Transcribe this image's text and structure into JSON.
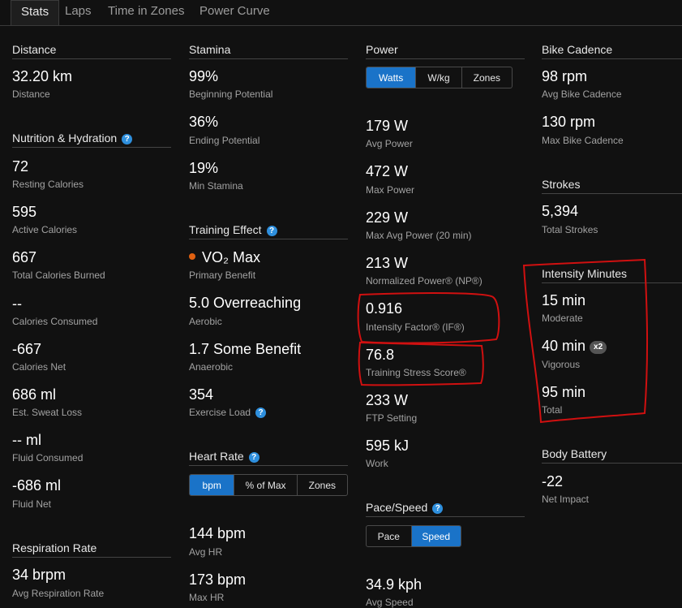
{
  "tabs": [
    "Stats",
    "Laps",
    "Time in Zones",
    "Power Curve"
  ],
  "distance": {
    "title": "Distance",
    "value": "32.20 km",
    "label": "Distance"
  },
  "nutrition": {
    "title": "Nutrition & Hydration",
    "items": [
      {
        "value": "72",
        "label": "Resting Calories"
      },
      {
        "value": "595",
        "label": "Active Calories"
      },
      {
        "value": "667",
        "label": "Total Calories Burned"
      },
      {
        "value": "--",
        "label": "Calories Consumed"
      },
      {
        "value": "-667",
        "label": "Calories Net"
      },
      {
        "value": "686 ml",
        "label": "Est. Sweat Loss"
      },
      {
        "value": "-- ml",
        "label": "Fluid Consumed"
      },
      {
        "value": "-686 ml",
        "label": "Fluid Net"
      }
    ]
  },
  "respiration": {
    "title": "Respiration Rate",
    "value": "34 brpm",
    "label": "Avg Respiration Rate"
  },
  "stamina": {
    "title": "Stamina",
    "items": [
      {
        "value": "99%",
        "label": "Beginning Potential"
      },
      {
        "value": "36%",
        "label": "Ending Potential"
      },
      {
        "value": "19%",
        "label": "Min Stamina"
      }
    ]
  },
  "training_effect": {
    "title": "Training Effect",
    "items": [
      {
        "value": "VO₂ Max",
        "label": "Primary Benefit"
      },
      {
        "value": "5.0 Overreaching",
        "label": "Aerobic"
      },
      {
        "value": "1.7 Some Benefit",
        "label": "Anaerobic"
      },
      {
        "value": "354",
        "label": "Exercise Load"
      }
    ],
    "dot_color": "#e06010"
  },
  "heart_rate": {
    "title": "Heart Rate",
    "toggle": [
      "bpm",
      "% of Max",
      "Zones"
    ],
    "items": [
      {
        "value": "144 bpm",
        "label": "Avg HR"
      },
      {
        "value": "173 bpm",
        "label": "Max HR"
      }
    ]
  },
  "power": {
    "title": "Power",
    "toggle": [
      "Watts",
      "W/kg",
      "Zones"
    ],
    "items": [
      {
        "value": "179 W",
        "label": "Avg Power"
      },
      {
        "value": "472 W",
        "label": "Max Power"
      },
      {
        "value": "229 W",
        "label": "Max Avg Power (20 min)"
      },
      {
        "value": "213 W",
        "label": "Normalized Power® (NP®)"
      },
      {
        "value": "0.916",
        "label": "Intensity Factor® (IF®)"
      },
      {
        "value": "76.8",
        "label": "Training Stress Score®"
      },
      {
        "value": "233 W",
        "label": "FTP Setting"
      },
      {
        "value": "595 kJ",
        "label": "Work"
      }
    ]
  },
  "pace_speed": {
    "title": "Pace/Speed",
    "toggle": [
      "Pace",
      "Speed"
    ],
    "items": [
      {
        "value": "34.9 kph",
        "label": "Avg Speed"
      }
    ]
  },
  "cadence": {
    "title": "Bike Cadence",
    "items": [
      {
        "value": "98 rpm",
        "label": "Avg Bike Cadence"
      },
      {
        "value": "130 rpm",
        "label": "Max Bike Cadence"
      }
    ]
  },
  "strokes": {
    "title": "Strokes",
    "value": "5,394",
    "label": "Total Strokes"
  },
  "intensity": {
    "title": "Intensity Minutes",
    "badge": "x2",
    "items": [
      {
        "value": "15 min",
        "label": "Moderate"
      },
      {
        "value": "40 min",
        "label": "Vigorous"
      },
      {
        "value": "95 min",
        "label": "Total"
      }
    ]
  },
  "body_battery": {
    "title": "Body Battery",
    "value": "-22",
    "label": "Net Impact"
  },
  "help_glyph": "?",
  "colors": {
    "accent": "#1a73c8",
    "background": "#111111",
    "annotation": "#d01010"
  }
}
